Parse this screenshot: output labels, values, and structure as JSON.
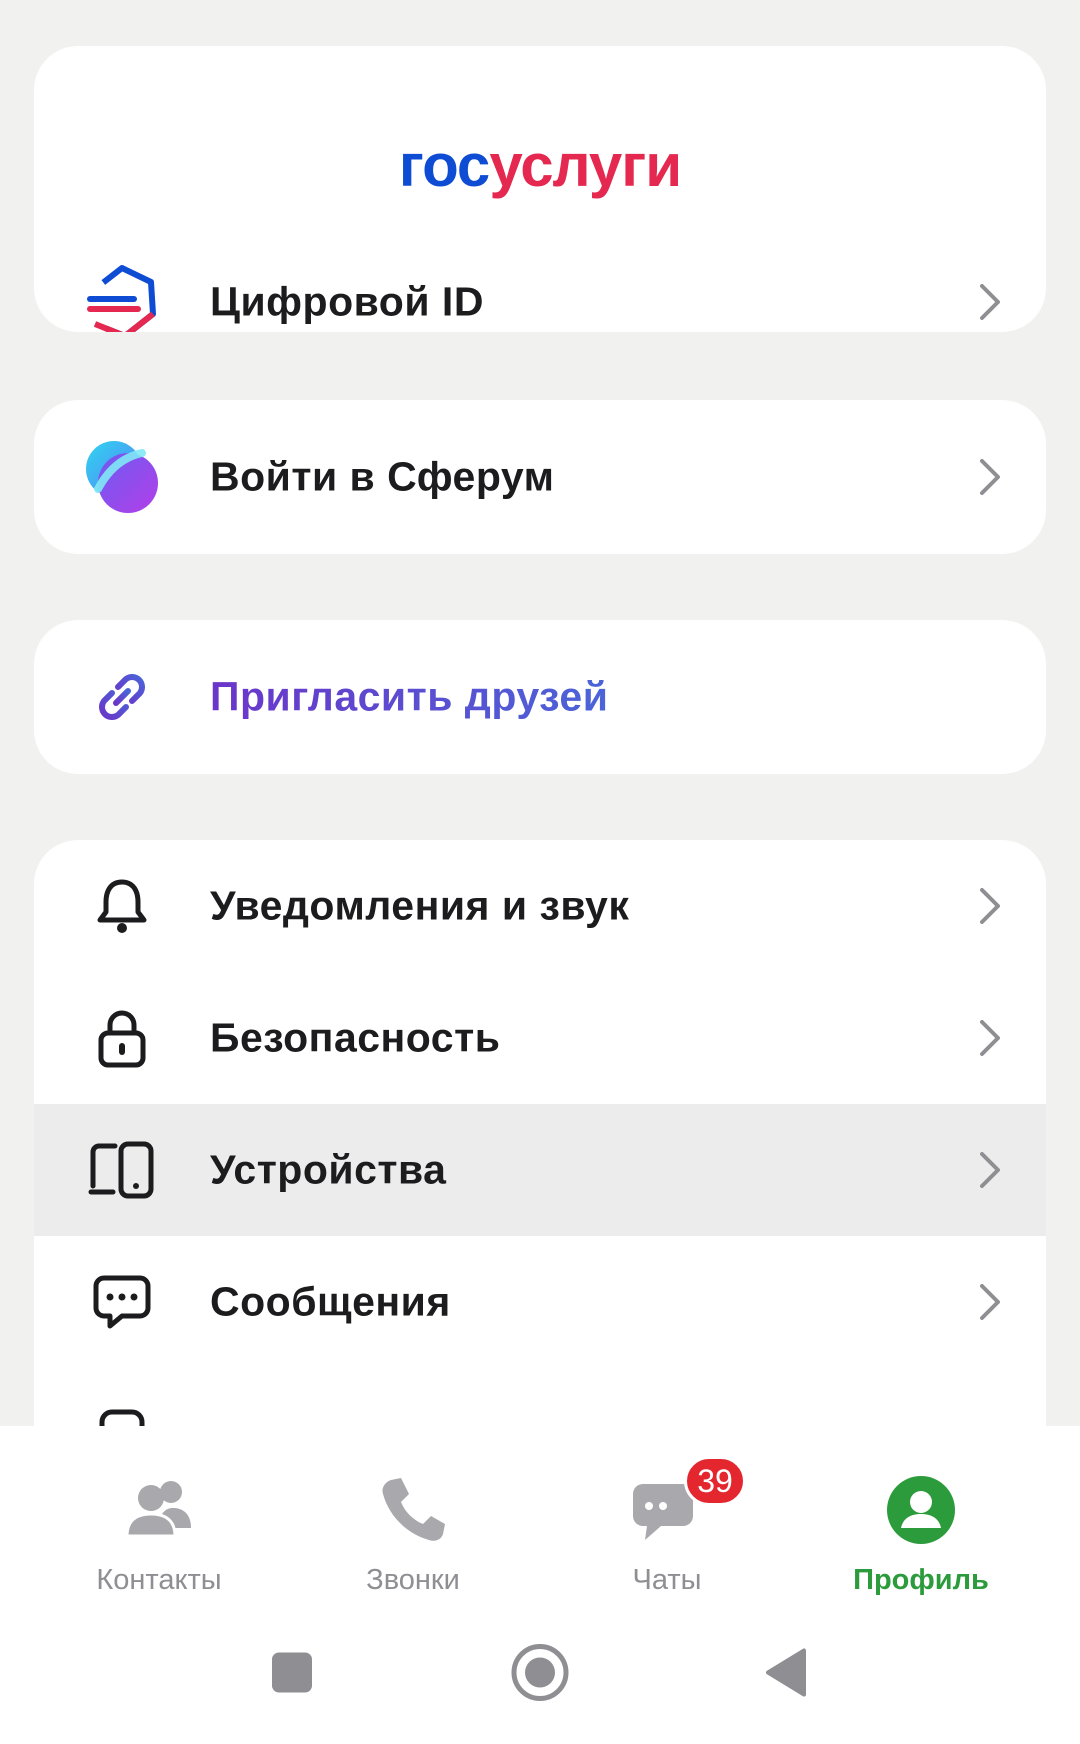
{
  "gosuslugi": {
    "logo_part1": "гос",
    "logo_part2": "услуги",
    "digital_id_label": "Цифровой ID"
  },
  "sferum": {
    "label": "Войти в Сферум"
  },
  "invite": {
    "label": "Пригласить друзей"
  },
  "settings": {
    "items": [
      {
        "label": "Уведомления и звук",
        "icon": "bell-icon"
      },
      {
        "label": "Безопасность",
        "icon": "lock-icon"
      },
      {
        "label": "Устройства",
        "icon": "devices-icon"
      },
      {
        "label": "Сообщения",
        "icon": "message-icon"
      }
    ]
  },
  "bottom_nav": {
    "items": [
      {
        "label": "Контакты",
        "icon": "contacts-icon"
      },
      {
        "label": "Звонки",
        "icon": "phone-icon"
      },
      {
        "label": "Чаты",
        "icon": "chat-icon",
        "badge": "39"
      },
      {
        "label": "Профиль",
        "icon": "profile-icon",
        "active": true
      }
    ]
  },
  "colors": {
    "accent_green": "#2c9b3b",
    "badge_red": "#e4262f",
    "gos_blue": "#0d4cd3",
    "gos_red": "#e4284f",
    "invite_purple": "#5a3fd1"
  }
}
